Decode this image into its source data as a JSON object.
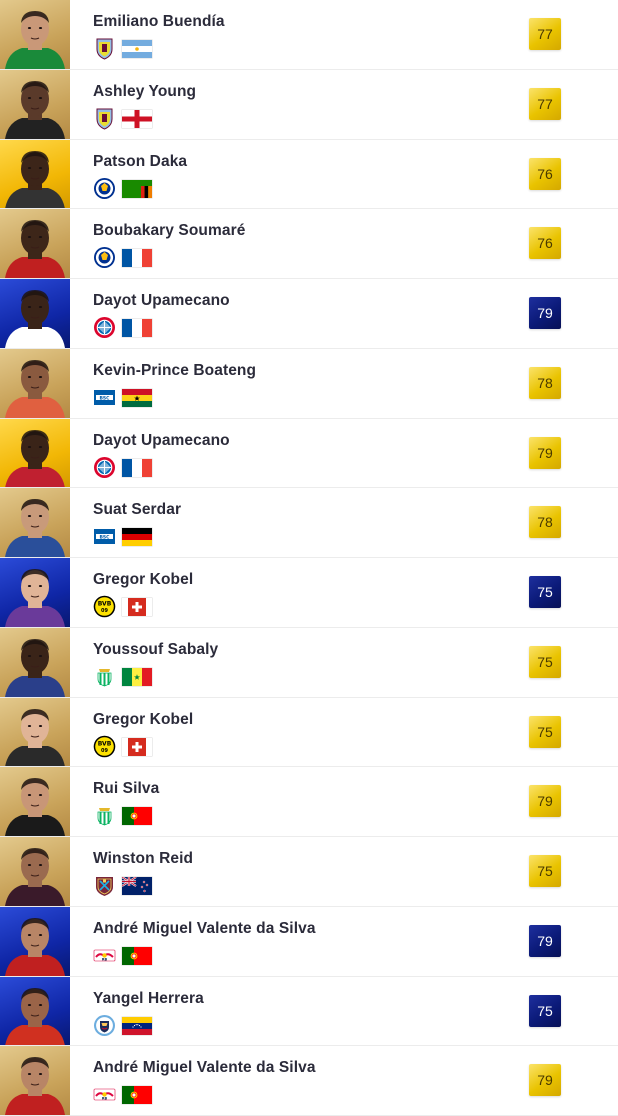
{
  "players": [
    {
      "name": "Emiliano Buendía",
      "rating": "77",
      "rating_tier": "gold",
      "photo_bg": "gold",
      "club_icon": "aston-villa-crest-icon",
      "flag_icon": "argentina-flag-icon",
      "skin": "#c99878",
      "shirt": "#1a8a3a"
    },
    {
      "name": "Ashley Young",
      "rating": "77",
      "rating_tier": "gold",
      "photo_bg": "gold",
      "club_icon": "aston-villa-crest-icon",
      "flag_icon": "england-flag-icon",
      "skin": "#5a3a2a",
      "shirt": "#222222"
    },
    {
      "name": "Patson Daka",
      "rating": "76",
      "rating_tier": "gold",
      "photo_bg": "yellow",
      "club_icon": "leicester-city-crest-icon",
      "flag_icon": "zambia-flag-icon",
      "skin": "#3c2519",
      "shirt": "#333333"
    },
    {
      "name": "Boubakary Soumaré",
      "rating": "76",
      "rating_tier": "gold",
      "photo_bg": "gold",
      "club_icon": "leicester-city-crest-icon",
      "flag_icon": "france-flag-icon",
      "skin": "#3d2619",
      "shirt": "#c02020"
    },
    {
      "name": "Dayot Upamecano",
      "rating": "79",
      "rating_tier": "blue",
      "photo_bg": "blue",
      "club_icon": "bayern-munich-crest-icon",
      "flag_icon": "france-flag-icon",
      "skin": "#3a2418",
      "shirt": "#ffffff"
    },
    {
      "name": "Kevin-Prince Boateng",
      "rating": "78",
      "rating_tier": "gold",
      "photo_bg": "gold",
      "club_icon": "hertha-berlin-crest-icon",
      "flag_icon": "ghana-flag-icon",
      "skin": "#8a5a3f",
      "shirt": "#e06040"
    },
    {
      "name": "Dayot Upamecano",
      "rating": "79",
      "rating_tier": "gold",
      "photo_bg": "yellow",
      "club_icon": "bayern-munich-crest-icon",
      "flag_icon": "france-flag-icon",
      "skin": "#3a2418",
      "shirt": "#c02030"
    },
    {
      "name": "Suat Serdar",
      "rating": "78",
      "rating_tier": "gold",
      "photo_bg": "gold",
      "club_icon": "hertha-berlin-crest-icon",
      "flag_icon": "germany-flag-icon",
      "skin": "#c89a7a",
      "shirt": "#2a4f9a"
    },
    {
      "name": "Gregor Kobel",
      "rating": "75",
      "rating_tier": "blue",
      "photo_bg": "blue",
      "club_icon": "borussia-dortmund-crest-icon",
      "flag_icon": "switzerland-flag-icon",
      "skin": "#e0b497",
      "shirt": "#6a3a9a"
    },
    {
      "name": "Youssouf Sabaly",
      "rating": "75",
      "rating_tier": "gold",
      "photo_bg": "gold",
      "club_icon": "real-betis-crest-icon",
      "flag_icon": "senegal-flag-icon",
      "skin": "#3a2418",
      "shirt": "#2a3f8a"
    },
    {
      "name": "Gregor Kobel",
      "rating": "75",
      "rating_tier": "gold",
      "photo_bg": "gold",
      "club_icon": "borussia-dortmund-crest-icon",
      "flag_icon": "switzerland-flag-icon",
      "skin": "#e0b497",
      "shirt": "#2a2a2a"
    },
    {
      "name": "Rui Silva",
      "rating": "79",
      "rating_tier": "gold",
      "photo_bg": "gold",
      "club_icon": "real-betis-crest-icon",
      "flag_icon": "portugal-flag-icon",
      "skin": "#c89677",
      "shirt": "#1a1a1a"
    },
    {
      "name": "Winston Reid",
      "rating": "75",
      "rating_tier": "gold",
      "photo_bg": "gold",
      "club_icon": "west-ham-crest-icon",
      "flag_icon": "new-zealand-flag-icon",
      "skin": "#9a6a4f",
      "shirt": "#3a1a2a"
    },
    {
      "name": "André Miguel Valente da Silva",
      "rating": "79",
      "rating_tier": "blue",
      "photo_bg": "blue",
      "club_icon": "rb-leipzig-crest-icon",
      "flag_icon": "portugal-flag-icon",
      "skin": "#b88566",
      "shirt": "#c02020"
    },
    {
      "name": "Yangel Herrera",
      "rating": "75",
      "rating_tier": "blue",
      "photo_bg": "blue",
      "club_icon": "manchester-city-crest-icon",
      "flag_icon": "venezuela-flag-icon",
      "skin": "#9a6448",
      "shirt": "#d03020"
    },
    {
      "name": "André Miguel Valente da Silva",
      "rating": "79",
      "rating_tier": "gold",
      "photo_bg": "gold",
      "club_icon": "rb-leipzig-crest-icon",
      "flag_icon": "portugal-flag-icon",
      "skin": "#b88566",
      "shirt": "#c02020"
    }
  ]
}
